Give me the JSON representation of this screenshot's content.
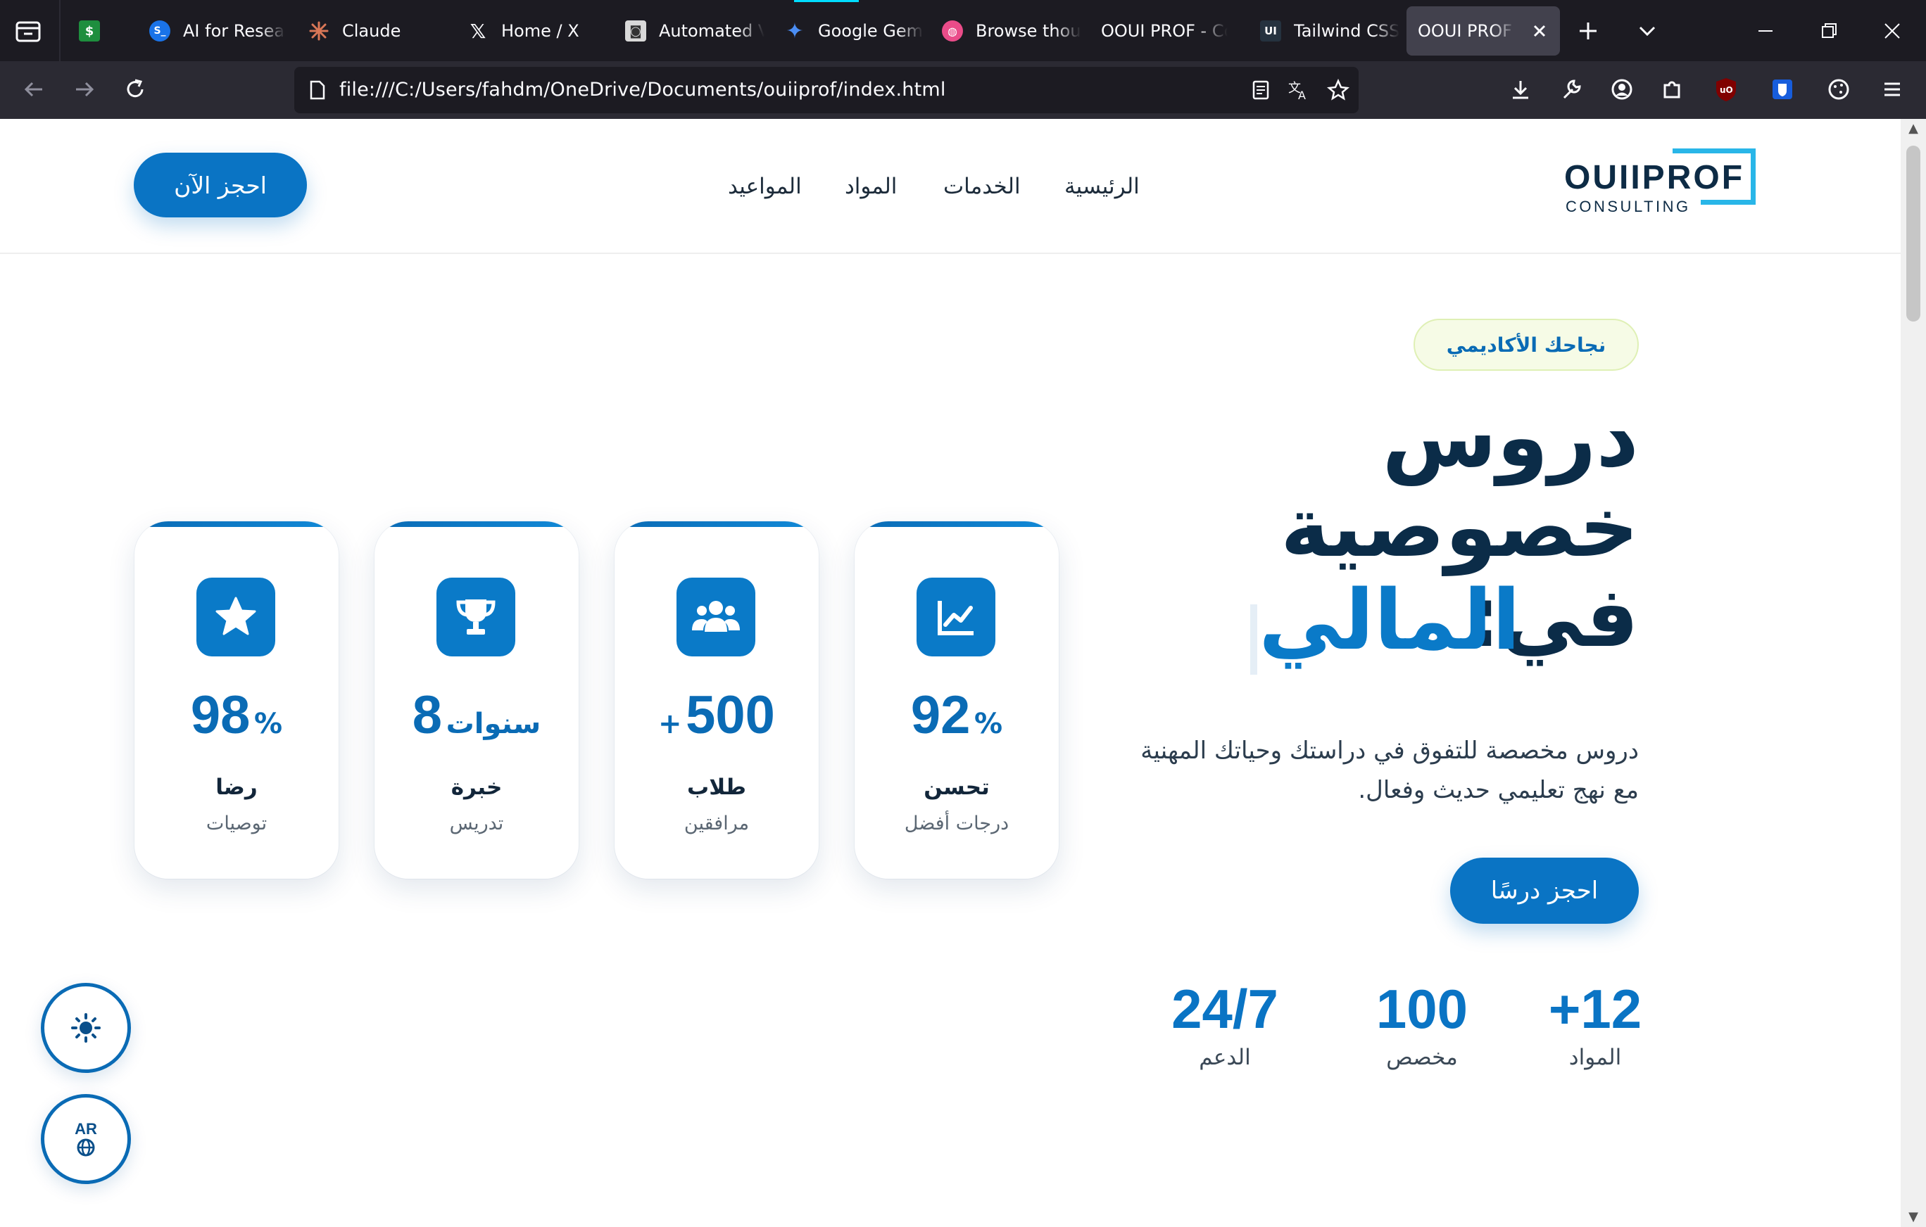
{
  "browser": {
    "tabs": [
      {
        "title": "",
        "favicon": "sheets-icon"
      },
      {
        "title": "AI for Research",
        "favicon": "research-icon"
      },
      {
        "title": "Claude",
        "favicon": "claude-icon"
      },
      {
        "title": "Home / X",
        "favicon": "x-icon"
      },
      {
        "title": "Automated V",
        "favicon": "bot-icon"
      },
      {
        "title": "Google Gemi",
        "favicon": "gemini-icon"
      },
      {
        "title": "Browse thous",
        "favicon": "dribbble-icon"
      },
      {
        "title": "OOUI PROF - Cou",
        "favicon": ""
      },
      {
        "title": "Tailwind CSS",
        "favicon": "ui-icon"
      },
      {
        "title": "OOUI PROF - C",
        "favicon": ""
      }
    ],
    "url": "file:///C:/Users/fahdm/OneDrive/Documents/ouiiprof/index.html"
  },
  "site": {
    "logo_main": "OUIIPROF",
    "logo_sub": "CONSULTING",
    "nav": [
      "الرئيسية",
      "الخدمات",
      "المواد",
      "المواعيد"
    ],
    "book_now": "احجز الآن",
    "badge": "نجاحك الأكاديمي",
    "hero_title_1": "دروس",
    "hero_title_2": "خصوصية في:",
    "hero_accent": "المالي",
    "hero_desc": "دروس مخصصة للتفوق في دراستك وحياتك المهنية مع نهج تعليمي حديث وفعال.",
    "hero_cta": "احجز درسًا",
    "mini_stats": [
      {
        "num": "+12",
        "label": "المواد"
      },
      {
        "num": "100",
        "label": "مخصص"
      },
      {
        "num": "24/7",
        "label": "الدعم"
      }
    ],
    "cards": [
      {
        "num": "92",
        "unit": "%",
        "title": "تحسن",
        "sub": "درجات أفضل",
        "icon": "chart-line-icon"
      },
      {
        "num": "500",
        "unit": "+",
        "title": "طلاب",
        "sub": "مرافقين",
        "icon": "users-icon"
      },
      {
        "num": "8",
        "unit": "سنوات",
        "title": "خبرة",
        "sub": "تدريس",
        "icon": "trophy-icon"
      },
      {
        "num": "98",
        "unit": "%",
        "title": "رضا",
        "sub": "توصيات",
        "icon": "star-icon"
      }
    ],
    "lang_button": "AR"
  }
}
